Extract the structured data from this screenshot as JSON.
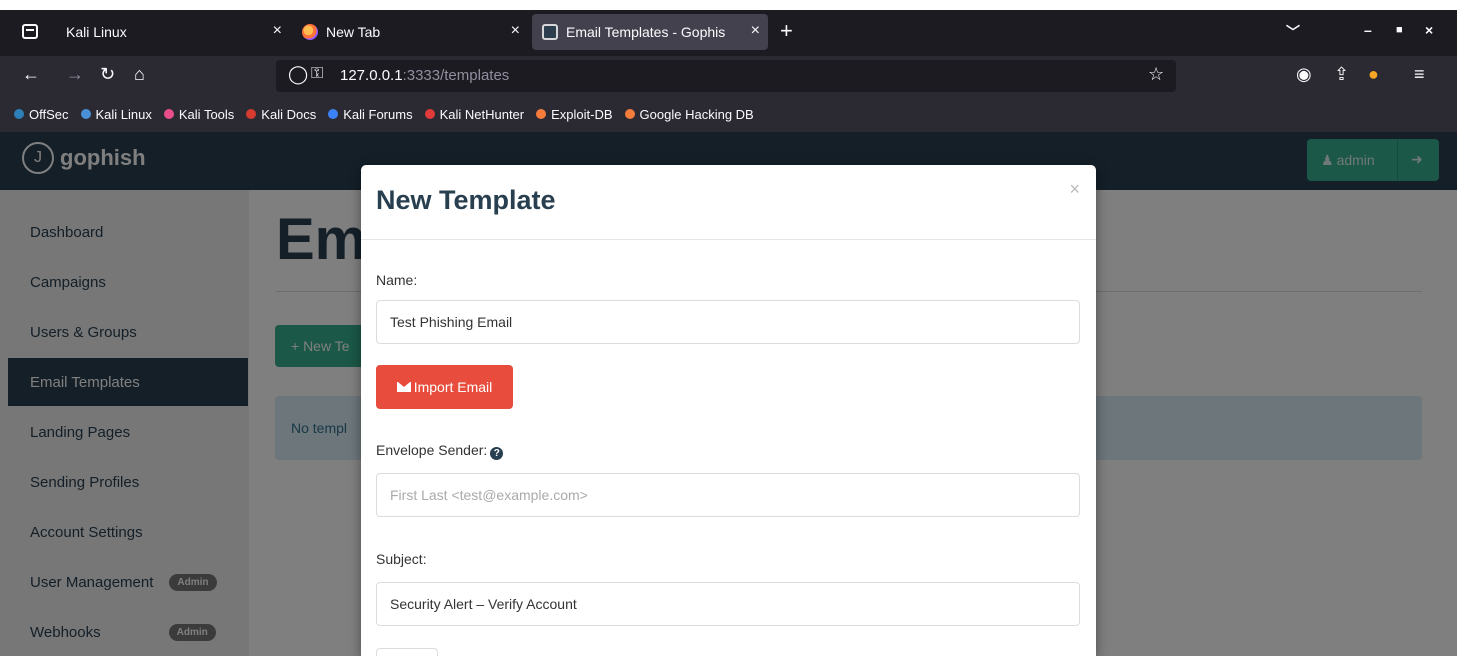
{
  "browser": {
    "tabs": [
      {
        "label": "Kali Linux",
        "close": "×"
      },
      {
        "label": "New Tab",
        "close": "×"
      },
      {
        "label": "Email Templates - Gophis",
        "close": "×"
      }
    ],
    "new_tab": "+",
    "window_controls": {
      "dropdown": "﹀",
      "minimize": "–",
      "maximize": "■",
      "close": "×"
    },
    "url": {
      "host": "127.0.0.1",
      "rest": ":3333/templates"
    },
    "bookmarks": [
      {
        "label": "OffSec",
        "color": "#2c7fb8"
      },
      {
        "label": "Kali Linux",
        "color": "#4a90d9"
      },
      {
        "label": "Kali Tools",
        "color": "#e94e8a"
      },
      {
        "label": "Kali Docs",
        "color": "#d63b2f"
      },
      {
        "label": "Kali Forums",
        "color": "#3b82f6"
      },
      {
        "label": "Kali NetHunter",
        "color": "#e03a3a"
      },
      {
        "label": "Exploit-DB",
        "color": "#f57c3b"
      },
      {
        "label": "Google Hacking DB",
        "color": "#f57c3b"
      }
    ]
  },
  "app": {
    "brand": "gophish",
    "brand_logo_glyph": "J",
    "user_button": "admin",
    "sidebar": [
      {
        "label": "Dashboard"
      },
      {
        "label": "Campaigns"
      },
      {
        "label": "Users & Groups"
      },
      {
        "label": "Email Templates"
      },
      {
        "label": "Landing Pages"
      },
      {
        "label": "Sending Profiles"
      },
      {
        "label": "Account Settings"
      },
      {
        "label": "User Management",
        "badge": "Admin"
      },
      {
        "label": "Webhooks",
        "badge": "Admin"
      }
    ],
    "page_title": "Em",
    "new_button": "+ New Te",
    "empty_message": "No templ"
  },
  "modal": {
    "title": "New Template",
    "close": "×",
    "name_label": "Name:",
    "name_value": "Test Phishing Email",
    "import_label": "Import Email",
    "envelope_label": "Envelope Sender:",
    "envelope_help": "?",
    "envelope_placeholder": "First Last <test@example.com>",
    "subject_label": "Subject:",
    "subject_value": "Security Alert – Verify Account"
  },
  "colors": {
    "navy": "#283f50",
    "green": "#37b08f",
    "red": "#e74c3c",
    "alert_bg": "#d9edf7"
  }
}
